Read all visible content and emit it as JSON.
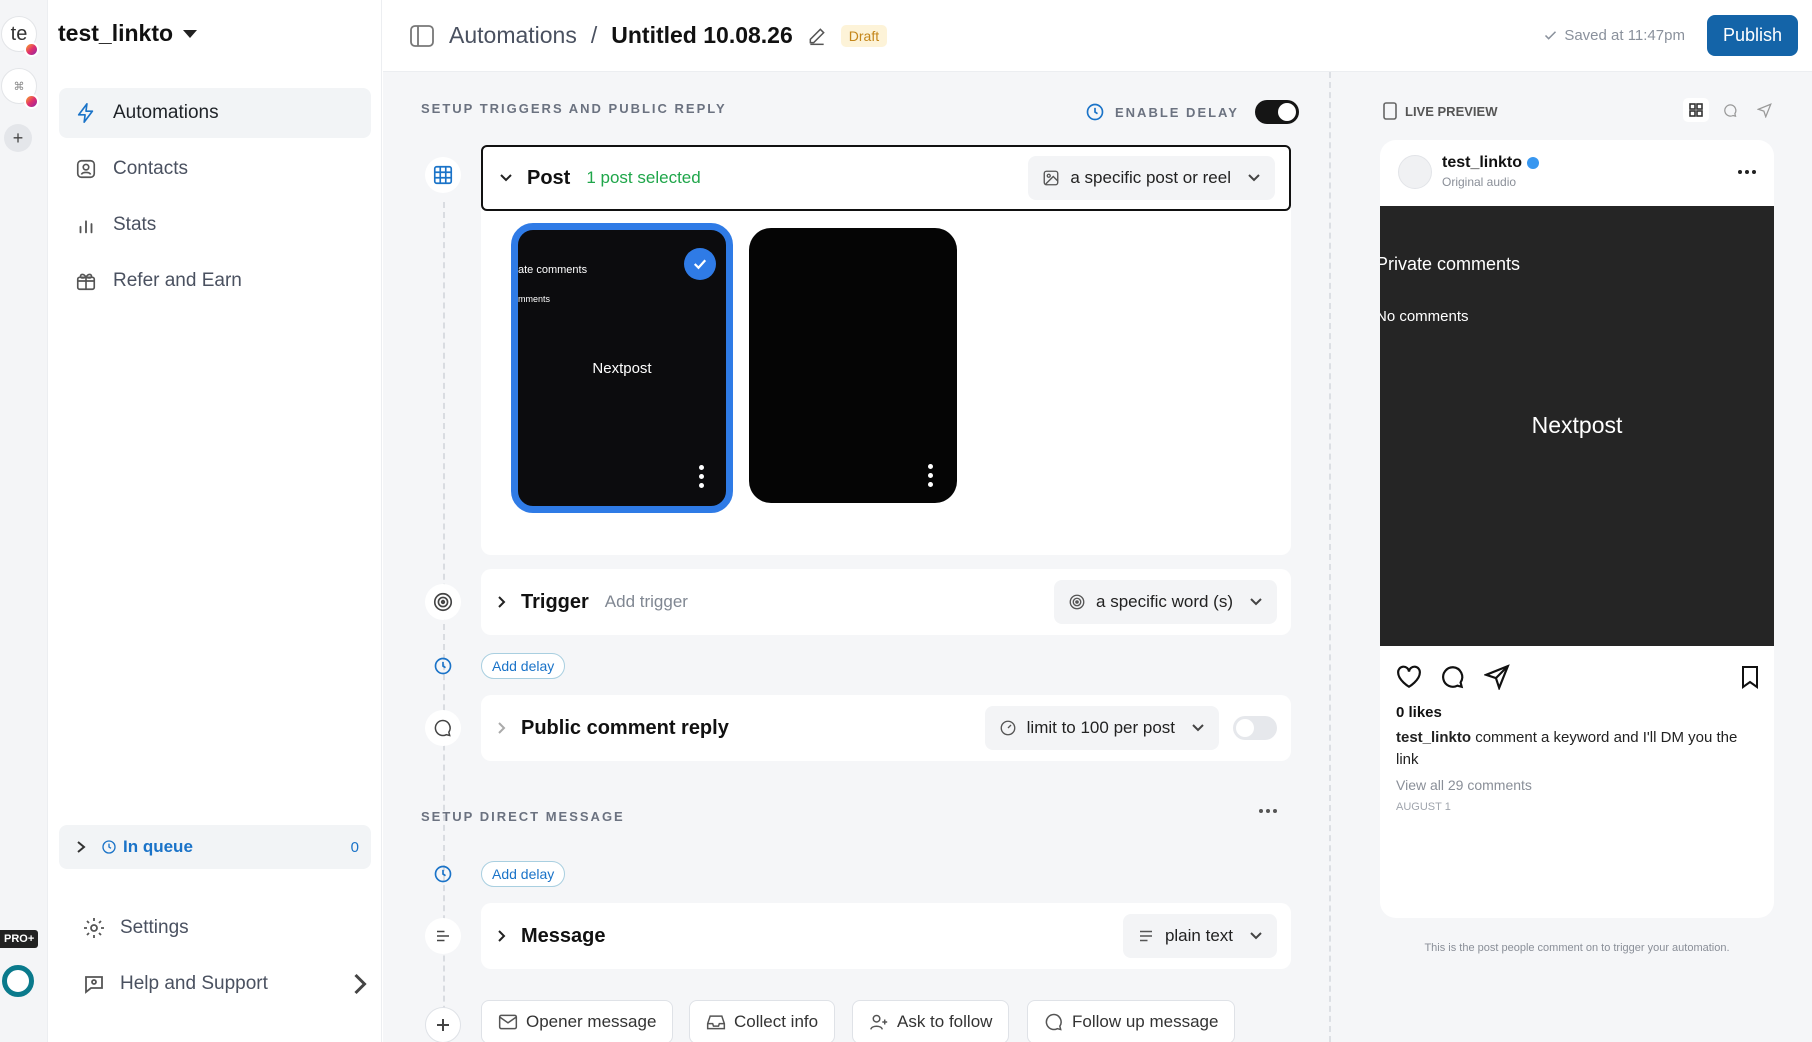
{
  "rail": {
    "ws1": "te",
    "add": "+",
    "pro": "PRO+"
  },
  "sidebar": {
    "account": "test_linkto",
    "nav": [
      {
        "label": "Automations",
        "icon": "bolt-icon"
      },
      {
        "label": "Contacts",
        "icon": "contact-icon"
      },
      {
        "label": "Stats",
        "icon": "stats-icon"
      },
      {
        "label": "Refer and Earn",
        "icon": "gift-icon"
      }
    ],
    "queue": {
      "label": "In queue",
      "count": "0"
    },
    "bottom": [
      {
        "label": "Settings",
        "icon": "gear-icon"
      },
      {
        "label": "Help and Support",
        "icon": "help-icon"
      }
    ]
  },
  "header": {
    "breadcrumb_root": "Automations",
    "separator": "/",
    "title": "Untitled 10.08.26",
    "status": "Draft",
    "saved": "Saved at 11:47pm",
    "publish": "Publish"
  },
  "main": {
    "triggers_label": "SETUP TRIGGERS AND PUBLIC REPLY",
    "enable_delay": "ENABLE DELAY",
    "enable_delay_on": true,
    "post": {
      "title": "Post",
      "selected": "1 post selected",
      "dropdown": "a specific post or reel",
      "thumb1_line1": "ate comments",
      "thumb1_line2": "mments",
      "thumb1_center": "Nextpost"
    },
    "trigger": {
      "title": "Trigger",
      "hint": "Add trigger",
      "dropdown": "a specific word (s)"
    },
    "add_delay_1": "Add delay",
    "public_reply": {
      "title": "Public comment reply",
      "dropdown": "limit to 100 per post",
      "enabled": false
    },
    "dm_label": "SETUP DIRECT MESSAGE",
    "add_delay_2": "Add delay",
    "message": {
      "title": "Message",
      "dropdown": "plain text"
    },
    "chips": [
      "Opener message",
      "Collect info",
      "Ask to follow",
      "Follow up message"
    ]
  },
  "preview": {
    "label": "LIVE PREVIEW",
    "username": "test_linkto",
    "audio": "Original audio",
    "media_line1": "Private comments",
    "media_line2": "No comments",
    "media_center": "Nextpost",
    "likes": "0 likes",
    "caption_user": "test_linkto",
    "caption_text": "comment a keyword and I'll DM you the link",
    "view_all": "View all 29 comments",
    "date": "AUGUST 1",
    "footnote": "This is the post people comment on to trigger your automation."
  },
  "colors": {
    "accent": "#1464a8",
    "success": "#1fa64a",
    "selected_border": "#2f7be6"
  }
}
